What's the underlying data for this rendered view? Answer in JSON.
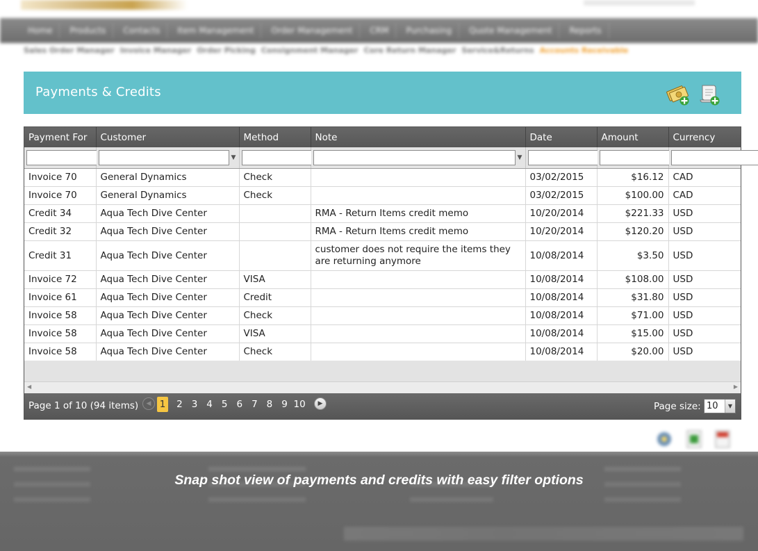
{
  "top_nav": [
    "Home",
    "Products",
    "Contacts",
    "Item Management",
    "Order Management",
    "CRM",
    "Purchasing",
    "Quote Management",
    "Reports"
  ],
  "sub_nav": {
    "items": [
      "Sales Order Manager",
      "Invoice Manager",
      "Order Picking",
      "Consignment Manager",
      "Core Return Manager",
      "Service&Returns"
    ],
    "active": "Accounts Receivable"
  },
  "panel": {
    "title": "Payments & Credits",
    "add_payment_icon": "money-add-icon",
    "add_credit_icon": "scroll-add-icon"
  },
  "grid": {
    "columns": [
      "Payment For",
      "Customer",
      "Method",
      "Note",
      "Date",
      "Amount",
      "Currency"
    ],
    "rows": [
      {
        "payment_for": "Invoice 70",
        "customer": "General Dynamics",
        "method": "Check",
        "note": "",
        "date": "03/02/2015",
        "amount": "$16.12",
        "currency": "CAD"
      },
      {
        "payment_for": "Invoice 70",
        "customer": "General Dynamics",
        "method": "Check",
        "note": "",
        "date": "03/02/2015",
        "amount": "$100.00",
        "currency": "CAD"
      },
      {
        "payment_for": "Credit 34",
        "customer": "Aqua Tech Dive Center",
        "method": "",
        "note": "RMA - Return Items credit memo",
        "date": "10/20/2014",
        "amount": "$221.33",
        "currency": "USD"
      },
      {
        "payment_for": "Credit 32",
        "customer": "Aqua Tech Dive Center",
        "method": "",
        "note": "RMA - Return Items credit memo",
        "date": "10/20/2014",
        "amount": "$120.20",
        "currency": "USD"
      },
      {
        "payment_for": "Credit 31",
        "customer": "Aqua Tech Dive Center",
        "method": "",
        "note": "customer does not require the items they are returning anymore",
        "date": "10/08/2014",
        "amount": "$3.50",
        "currency": "USD"
      },
      {
        "payment_for": "Invoice 72",
        "customer": "Aqua Tech Dive Center",
        "method": "VISA",
        "note": "",
        "date": "10/08/2014",
        "amount": "$108.00",
        "currency": "USD"
      },
      {
        "payment_for": "Invoice 61",
        "customer": "Aqua Tech Dive Center",
        "method": "Credit",
        "note": "",
        "date": "10/08/2014",
        "amount": "$31.80",
        "currency": "USD"
      },
      {
        "payment_for": "Invoice 58",
        "customer": "Aqua Tech Dive Center",
        "method": "Check",
        "note": "",
        "date": "10/08/2014",
        "amount": "$71.00",
        "currency": "USD"
      },
      {
        "payment_for": "Invoice 58",
        "customer": "Aqua Tech Dive Center",
        "method": "VISA",
        "note": "",
        "date": "10/08/2014",
        "amount": "$15.00",
        "currency": "USD"
      },
      {
        "payment_for": "Invoice 58",
        "customer": "Aqua Tech Dive Center",
        "method": "Check",
        "note": "",
        "date": "10/08/2014",
        "amount": "$20.00",
        "currency": "USD"
      }
    ]
  },
  "pager": {
    "info": "Page 1 of 10 (94 items)",
    "pages": [
      "1",
      "2",
      "3",
      "4",
      "5",
      "6",
      "7",
      "8",
      "9",
      "10"
    ],
    "current": "1",
    "page_size_label": "Page size:",
    "page_size": "10"
  },
  "exports": [
    "export-settings-icon",
    "export-excel-icon",
    "export-pdf-icon"
  ],
  "caption": "Snap shot view of payments and credits with easy filter options"
}
